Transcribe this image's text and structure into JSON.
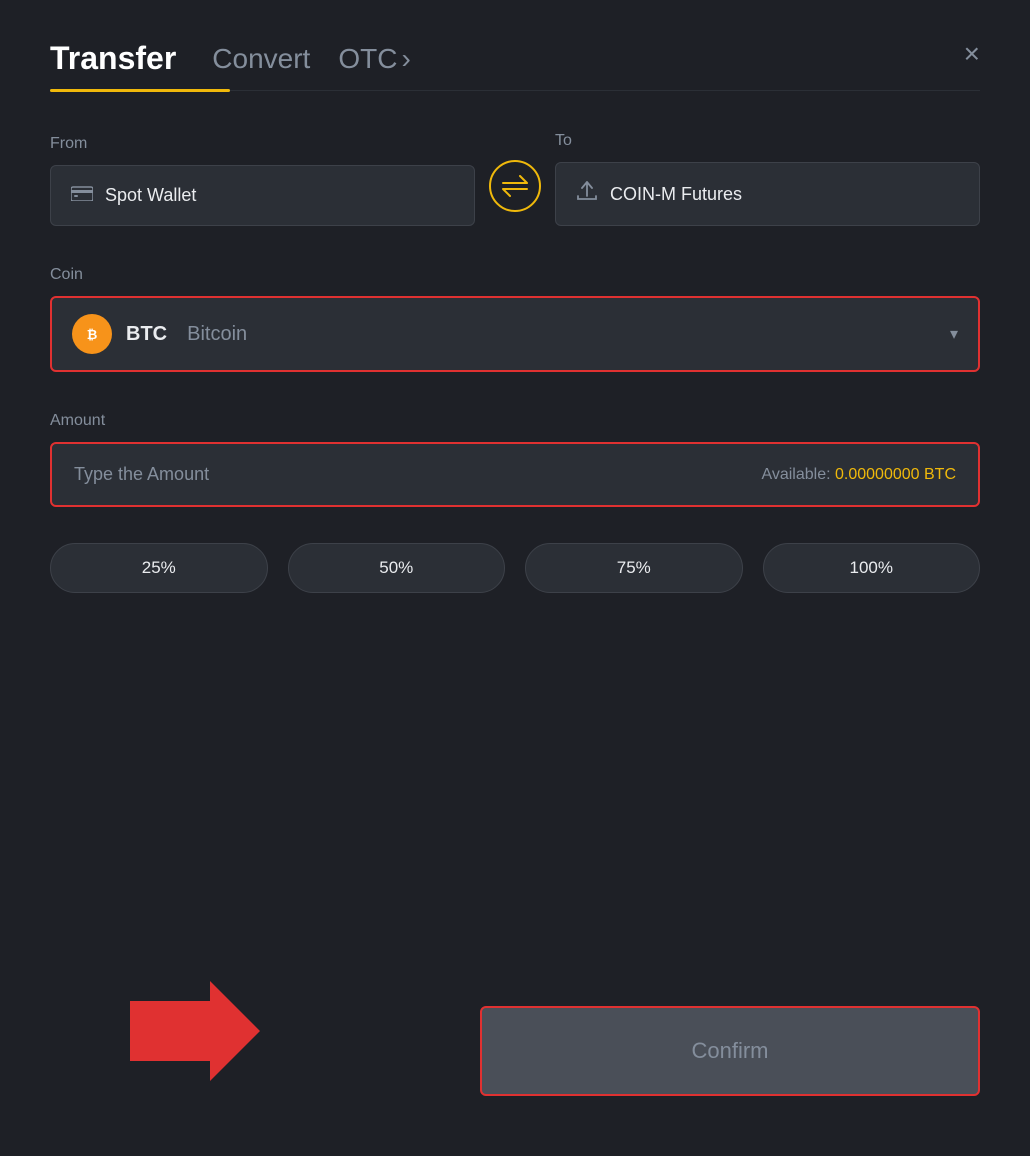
{
  "header": {
    "tab_transfer": "Transfer",
    "tab_convert": "Convert",
    "tab_otc": "OTC",
    "tab_otc_chevron": "›",
    "close_label": "×"
  },
  "from": {
    "label": "From",
    "wallet_icon": "▬",
    "wallet_name": "Spot Wallet"
  },
  "to": {
    "label": "To",
    "wallet_icon": "↑",
    "wallet_name": "COIN-M Futures"
  },
  "swap": {
    "icon": "⇄"
  },
  "coin": {
    "label": "Coin",
    "icon_letter": "₿",
    "symbol": "BTC",
    "name": "Bitcoin",
    "chevron": "▾"
  },
  "amount": {
    "label": "Amount",
    "placeholder": "Type the Amount",
    "available_label": "Available:",
    "available_value": "0.00000000 BTC"
  },
  "percentages": [
    {
      "label": "25%"
    },
    {
      "label": "50%"
    },
    {
      "label": "75%"
    },
    {
      "label": "100%"
    }
  ],
  "confirm": {
    "label": "Confirm"
  }
}
